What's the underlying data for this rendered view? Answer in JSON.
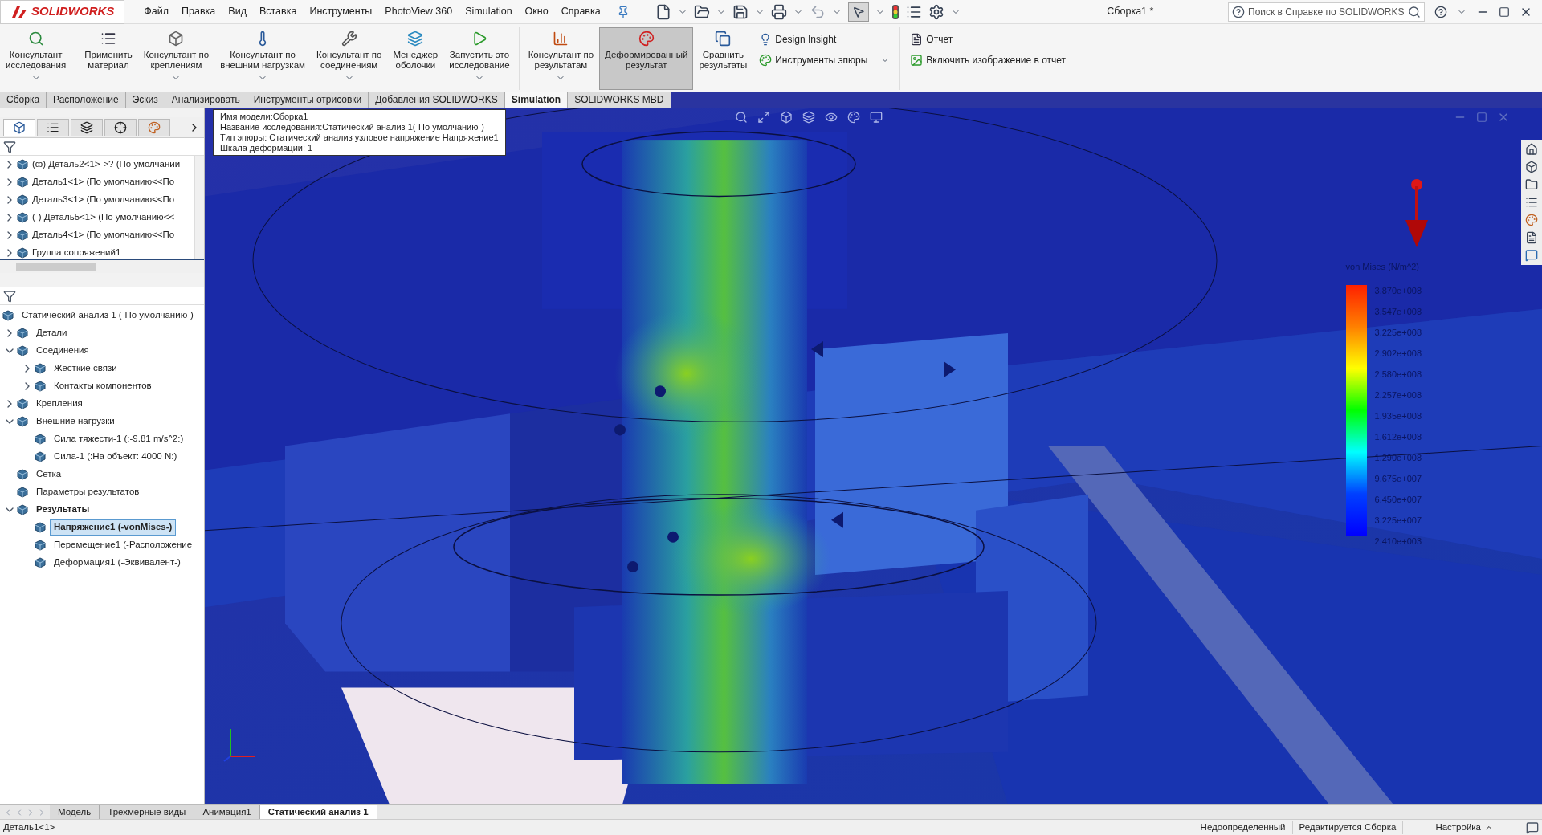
{
  "window": {
    "title": "Сборка1 *",
    "logo": "SOLIDWORKS",
    "search": {
      "placeholder": "Поиск в Справке по SOLIDWORKS"
    }
  },
  "menu": [
    "Файл",
    "Правка",
    "Вид",
    "Вставка",
    "Инструменты",
    "PhotoView 360",
    "Simulation",
    "Окно",
    "Справка"
  ],
  "ribbon": {
    "buttons": [
      {
        "label": "Консультант\nисследования",
        "dropdown": true,
        "selected": false
      },
      {
        "label": "Применить\nматериал",
        "dropdown": false,
        "selected": false
      },
      {
        "label": "Консультант по\nкреплениям",
        "dropdown": true,
        "selected": false
      },
      {
        "label": "Консультант по\nвнешним нагрузкам",
        "dropdown": true,
        "selected": false
      },
      {
        "label": "Консультант по\nсоединениям",
        "dropdown": true,
        "selected": false
      },
      {
        "label": "Менеджер\nоболочки",
        "dropdown": false,
        "selected": false
      },
      {
        "label": "Запустить это\nисследование",
        "dropdown": true,
        "selected": false
      },
      {
        "label": "Консультант по\nрезультатам",
        "dropdown": true,
        "selected": false
      },
      {
        "label": "Деформированный\nрезультат",
        "dropdown": false,
        "selected": true
      },
      {
        "label": "Сравнить\nрезультаты",
        "dropdown": false,
        "selected": false
      }
    ],
    "small_left": [
      {
        "label": "Design Insight",
        "dropdown": false
      },
      {
        "label": "Инструменты эпюры",
        "dropdown": true
      }
    ],
    "small_right": [
      {
        "label": "Отчет"
      },
      {
        "label": "Включить изображение в отчет"
      }
    ]
  },
  "command_tabs": [
    {
      "label": "Сборка",
      "selected": false
    },
    {
      "label": "Расположение",
      "selected": false
    },
    {
      "label": "Эскиз",
      "selected": false
    },
    {
      "label": "Анализировать",
      "selected": false
    },
    {
      "label": "Инструменты отрисовки",
      "selected": false
    },
    {
      "label": "Добавления SOLIDWORKS",
      "selected": false
    },
    {
      "label": "Simulation",
      "selected": true
    },
    {
      "label": "SOLIDWORKS MBD",
      "selected": false
    }
  ],
  "feature_tree": [
    {
      "label": "(ф) Деталь2<1>->? (По умолчании",
      "expanded": false
    },
    {
      "label": "Деталь1<1> (По умолчанию<<По",
      "expanded": false
    },
    {
      "label": "Деталь3<1> (По умолчанию<<По",
      "expanded": false
    },
    {
      "label": "(-) Деталь5<1> (По умолчанию<<",
      "expanded": false
    },
    {
      "label": "Деталь4<1> (По умолчанию<<По",
      "expanded": false
    },
    {
      "label": "Группа сопряжений1",
      "expanded": false
    }
  ],
  "sim_tree": [
    {
      "label": "Статический анализ 1 (-По умолчанию-)",
      "selected": false,
      "bold": false,
      "children": [
        {
          "label": "Детали",
          "expanded": false,
          "selected": false,
          "bold": false
        },
        {
          "label": "Соединения",
          "expanded": true,
          "selected": false,
          "bold": false,
          "children": [
            {
              "label": "Жесткие связи",
              "expanded": false,
              "selected": false,
              "bold": false
            },
            {
              "label": "Контакты компонентов",
              "expanded": false,
              "selected": false,
              "bold": false
            }
          ]
        },
        {
          "label": "Крепления",
          "expanded": false,
          "selected": false,
          "bold": false
        },
        {
          "label": "Внешние нагрузки",
          "expanded": true,
          "selected": false,
          "bold": false,
          "children": [
            {
              "label": "Сила тяжести-1 (:-9.81 m/s^2:)",
              "selected": false,
              "bold": false
            },
            {
              "label": "Сила-1 (:На объект: 4000 N:)",
              "selected": false,
              "bold": false
            }
          ]
        },
        {
          "label": "Сетка",
          "selected": false,
          "bold": false
        },
        {
          "label": "Параметры результатов",
          "selected": false,
          "bold": false
        },
        {
          "label": "Результаты",
          "expanded": true,
          "selected": false,
          "bold": true,
          "children": [
            {
              "label": "Напряжение1 (-vonMises-)",
              "selected": true,
              "bold": true
            },
            {
              "label": "Перемещение1 (-Расположение",
              "selected": false,
              "bold": false
            },
            {
              "label": "Деформация1 (-Эквивалент-)",
              "selected": false,
              "bold": false
            }
          ]
        }
      ]
    }
  ],
  "model_info": [
    "Имя модели:Сборка1",
    "Название исследования:Статический анализ 1(-По умолчанию-)",
    "Тип эпюры: Статический анализ узловое напряжение Напряжение1",
    "Шкала деформации: 1"
  ],
  "legend": {
    "title": "von Mises (N/m^2)",
    "values": [
      "3.870e+008",
      "3.547e+008",
      "3.225e+008",
      "2.902e+008",
      "2.580e+008",
      "2.257e+008",
      "1.935e+008",
      "1.612e+008",
      "1.290e+008",
      "9.675e+007",
      "6.450e+007",
      "3.225e+007",
      "2.410e+003"
    ]
  },
  "bottom_tabs": [
    {
      "label": "Модель",
      "selected": false
    },
    {
      "label": "Трехмерные виды",
      "selected": false
    },
    {
      "label": "Анимация1",
      "selected": false
    },
    {
      "label": "Статический анализ 1",
      "selected": true
    }
  ],
  "status_bar": {
    "left": "Деталь1<1>",
    "items": [
      "Недоопределенный",
      "Редактируется Сборка"
    ],
    "settings": "Настройка"
  }
}
